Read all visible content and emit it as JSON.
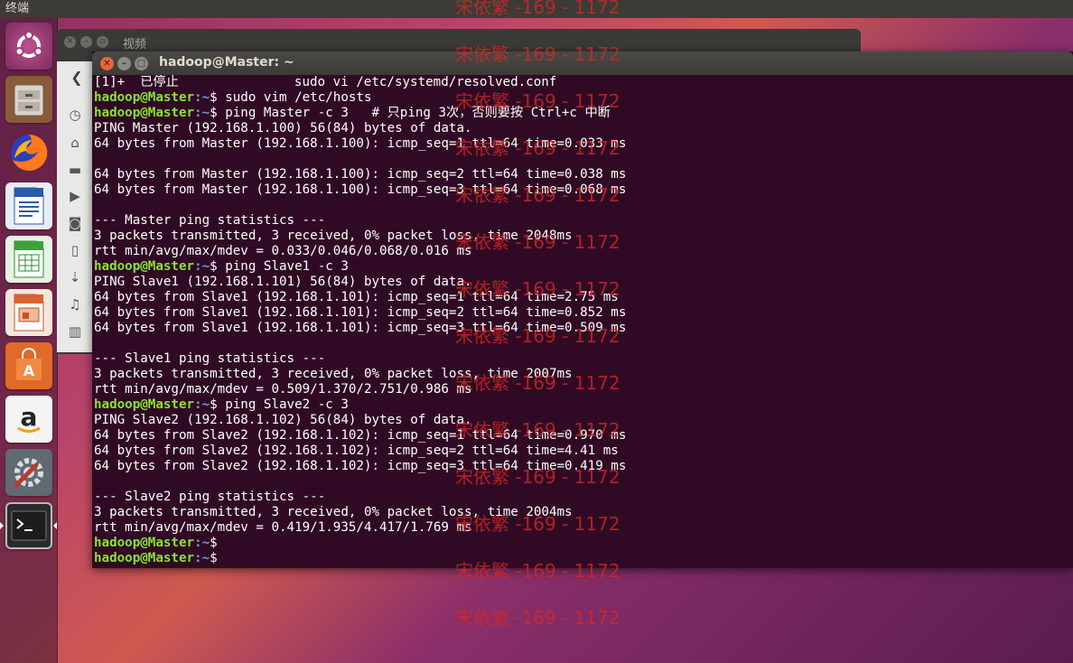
{
  "topbar": {
    "title": "终端"
  },
  "launcher": {
    "items": [
      {
        "name": "ubuntu-dash",
        "icon": "ubuntu-logo-icon"
      },
      {
        "name": "files",
        "icon": "file-cabinet-icon"
      },
      {
        "name": "firefox",
        "icon": "firefox-icon"
      },
      {
        "name": "writer",
        "icon": "writer-document-icon"
      },
      {
        "name": "calc",
        "icon": "calc-spreadsheet-icon"
      },
      {
        "name": "impress",
        "icon": "impress-presentation-icon"
      },
      {
        "name": "software-center",
        "icon": "shopping-bag-icon"
      },
      {
        "name": "amazon",
        "icon": "amazon-icon"
      },
      {
        "name": "settings",
        "icon": "settings-wrench-icon"
      },
      {
        "name": "terminal",
        "icon": "terminal-icon"
      }
    ]
  },
  "background_window": {
    "title": "视频",
    "sidebar_icons": [
      "clock-icon",
      "home-icon",
      "folder-icon",
      "video-icon",
      "camera-icon",
      "document-icon",
      "download-icon",
      "music-icon",
      "trash-icon"
    ]
  },
  "terminal": {
    "title": "hadoop@Master: ~",
    "prompt_user": "hadoop@Master",
    "prompt_path": ":~",
    "prompt_symbol": "$",
    "lines": [
      {
        "type": "out",
        "text": "[1]+  已停止               sudo vi /etc/systemd/resolved.conf"
      },
      {
        "type": "cmd",
        "text": " sudo vim /etc/hosts"
      },
      {
        "type": "cmd",
        "text": " ping Master -c 3   # 只ping 3次，否则要按 Ctrl+c 中断"
      },
      {
        "type": "out",
        "text": "PING Master (192.168.1.100) 56(84) bytes of data."
      },
      {
        "type": "out",
        "text": "64 bytes from Master (192.168.1.100): icmp_seq=1 ttl=64 time=0.033 ms"
      },
      {
        "type": "out",
        "text": ""
      },
      {
        "type": "out",
        "text": "64 bytes from Master (192.168.1.100): icmp_seq=2 ttl=64 time=0.038 ms"
      },
      {
        "type": "out",
        "text": "64 bytes from Master (192.168.1.100): icmp_seq=3 ttl=64 time=0.068 ms"
      },
      {
        "type": "out",
        "text": ""
      },
      {
        "type": "out",
        "text": "--- Master ping statistics ---"
      },
      {
        "type": "out",
        "text": "3 packets transmitted, 3 received, 0% packet loss, time 2048ms"
      },
      {
        "type": "out",
        "text": "rtt min/avg/max/mdev = 0.033/0.046/0.068/0.016 ms"
      },
      {
        "type": "cmd",
        "text": " ping Slave1 -c 3"
      },
      {
        "type": "out",
        "text": "PING Slave1 (192.168.1.101) 56(84) bytes of data."
      },
      {
        "type": "out",
        "text": "64 bytes from Slave1 (192.168.1.101): icmp_seq=1 ttl=64 time=2.75 ms"
      },
      {
        "type": "out",
        "text": "64 bytes from Slave1 (192.168.1.101): icmp_seq=2 ttl=64 time=0.852 ms"
      },
      {
        "type": "out",
        "text": "64 bytes from Slave1 (192.168.1.101): icmp_seq=3 ttl=64 time=0.509 ms"
      },
      {
        "type": "out",
        "text": ""
      },
      {
        "type": "out",
        "text": "--- Slave1 ping statistics ---"
      },
      {
        "type": "out",
        "text": "3 packets transmitted, 3 received, 0% packet loss, time 2007ms"
      },
      {
        "type": "out",
        "text": "rtt min/avg/max/mdev = 0.509/1.370/2.751/0.986 ms"
      },
      {
        "type": "cmd",
        "text": " ping Slave2 -c 3"
      },
      {
        "type": "out",
        "text": "PING Slave2 (192.168.1.102) 56(84) bytes of data."
      },
      {
        "type": "out",
        "text": "64 bytes from Slave2 (192.168.1.102): icmp_seq=1 ttl=64 time=0.970 ms"
      },
      {
        "type": "out",
        "text": "64 bytes from Slave2 (192.168.1.102): icmp_seq=2 ttl=64 time=4.41 ms"
      },
      {
        "type": "out",
        "text": "64 bytes from Slave2 (192.168.1.102): icmp_seq=3 ttl=64 time=0.419 ms"
      },
      {
        "type": "out",
        "text": ""
      },
      {
        "type": "out",
        "text": "--- Slave2 ping statistics ---"
      },
      {
        "type": "out",
        "text": "3 packets transmitted, 3 received, 0% packet loss, time 2004ms"
      },
      {
        "type": "out",
        "text": "rtt min/avg/max/mdev = 0.419/1.935/4.417/1.769 ms"
      },
      {
        "type": "cmd",
        "text": ""
      },
      {
        "type": "cmd",
        "text": ""
      }
    ]
  },
  "watermark": {
    "text": "宋依繁 -169 - 1172"
  },
  "colors": {
    "terminal_bg": "#300a24",
    "prompt_user": "#8ae234",
    "prompt_path": "#729fcf",
    "watermark": "#d62626"
  }
}
